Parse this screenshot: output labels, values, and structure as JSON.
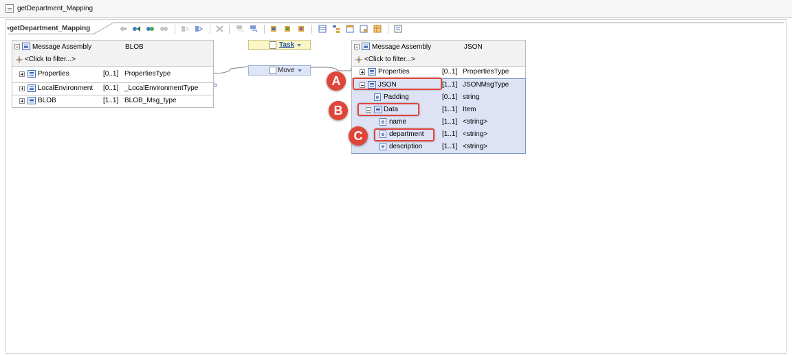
{
  "window": {
    "title": "getDepartment_Mapping"
  },
  "editor": {
    "tab_label": "getDepartment_Mapping",
    "tab_arrow": "▾"
  },
  "toolbar": {
    "icons": [
      "back-icon",
      "forward-icon",
      "map-icon",
      "map-alt-icon",
      "search-prev-icon",
      "search-next-icon",
      "delete-icon",
      "collapse-icon",
      "expand-icon",
      "tool-1-icon",
      "tool-2-icon",
      "tool-3-icon",
      "grid-icon",
      "tree-icon",
      "table-icon",
      "table-edit-icon",
      "table-x-icon",
      "properties-icon"
    ]
  },
  "source": {
    "header": {
      "name": "Message Assembly",
      "type": "BLOB"
    },
    "filter": "<Click to filter...>",
    "rows": [
      {
        "name": "Properties",
        "card": "[0..1]",
        "type": "PropertiesType"
      },
      {
        "name": "LocalEnvironment",
        "card": "[0..1]",
        "type": "_LocalEnvironmentType"
      },
      {
        "name": "BLOB",
        "card": "[1..1]",
        "type": "BLOB_Msg_type"
      }
    ]
  },
  "transforms": {
    "task": {
      "label": "Task"
    },
    "move": {
      "label": "Move"
    }
  },
  "target": {
    "header": {
      "name": "Message Assembly",
      "type": "JSON"
    },
    "filter": "<Click to filter...>",
    "rows": [
      {
        "name": "Properties",
        "card": "[0..1]",
        "type": "PropertiesType"
      },
      {
        "name": "JSON",
        "card": "[1..1]",
        "type": "JSONMsgType"
      },
      {
        "name": "Padding",
        "card": "[0..1]",
        "type": "string"
      },
      {
        "name": "Data",
        "card": "[1..1]",
        "type": "Item"
      },
      {
        "name": "name",
        "card": "[1..1]",
        "type": "<string>"
      },
      {
        "name": "department",
        "card": "[1..1]",
        "type": "<string>"
      },
      {
        "name": "description",
        "card": "[1..1]",
        "type": "<string>"
      }
    ]
  },
  "annotations": {
    "a": "A",
    "b": "B",
    "c": "C"
  },
  "colors": {
    "accent": "#e0453a",
    "selection": "#dde3f5",
    "border": "#7a95cc"
  }
}
